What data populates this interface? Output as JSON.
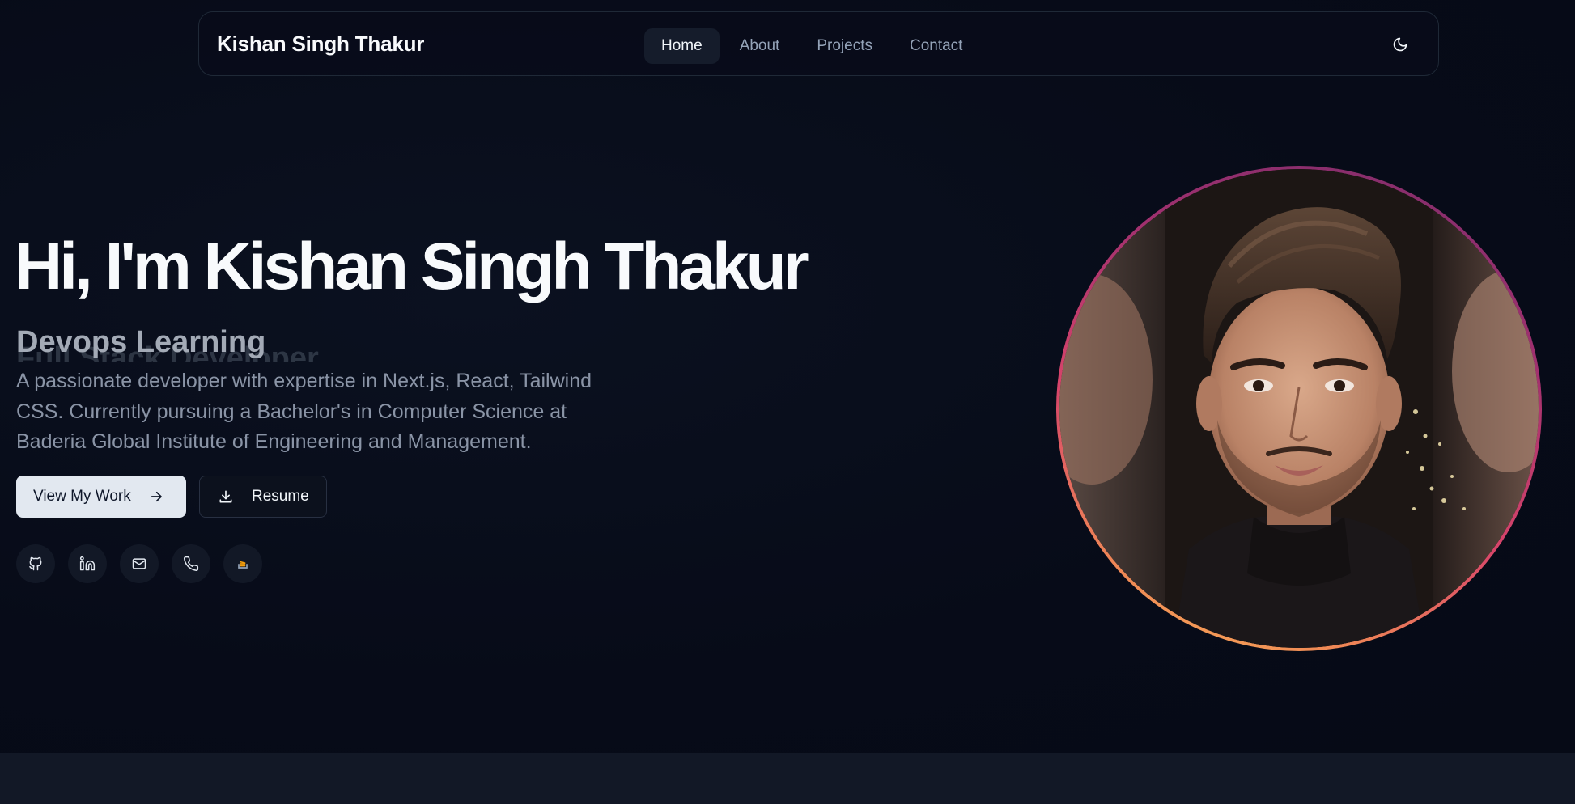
{
  "nav": {
    "brand": "Kishan Singh Thakur",
    "links": [
      {
        "label": "Home",
        "active": true
      },
      {
        "label": "About",
        "active": false
      },
      {
        "label": "Projects",
        "active": false
      },
      {
        "label": "Contact",
        "active": false
      }
    ],
    "theme_icon": "moon-icon"
  },
  "hero": {
    "title": "Hi, I'm Kishan Singh Thakur",
    "role_current": "Devops Learning",
    "role_next": "Full Stack Developer",
    "description": "A passionate developer with expertise in Next.js, React, Tailwind CSS. Currently pursuing a Bachelor's in Computer Science at Baderia Global Institute of Engineering and Management.",
    "primary_button": {
      "label": "View My Work",
      "icon": "arrow-right-icon"
    },
    "secondary_button": {
      "label": "Resume",
      "icon": "download-icon"
    }
  },
  "social": [
    {
      "name": "github",
      "icon": "github-icon"
    },
    {
      "name": "linkedin",
      "icon": "linkedin-icon"
    },
    {
      "name": "email",
      "icon": "mail-icon"
    },
    {
      "name": "phone",
      "icon": "phone-icon"
    },
    {
      "name": "stackoverflow",
      "icon": "stackoverflow-icon"
    }
  ],
  "colors": {
    "background": "#070b18",
    "accent_ring_start": "#7c2d6b",
    "accent_ring_end": "#fbbf5a",
    "text_primary": "#f8fafc",
    "text_muted": "#8a94a6"
  }
}
